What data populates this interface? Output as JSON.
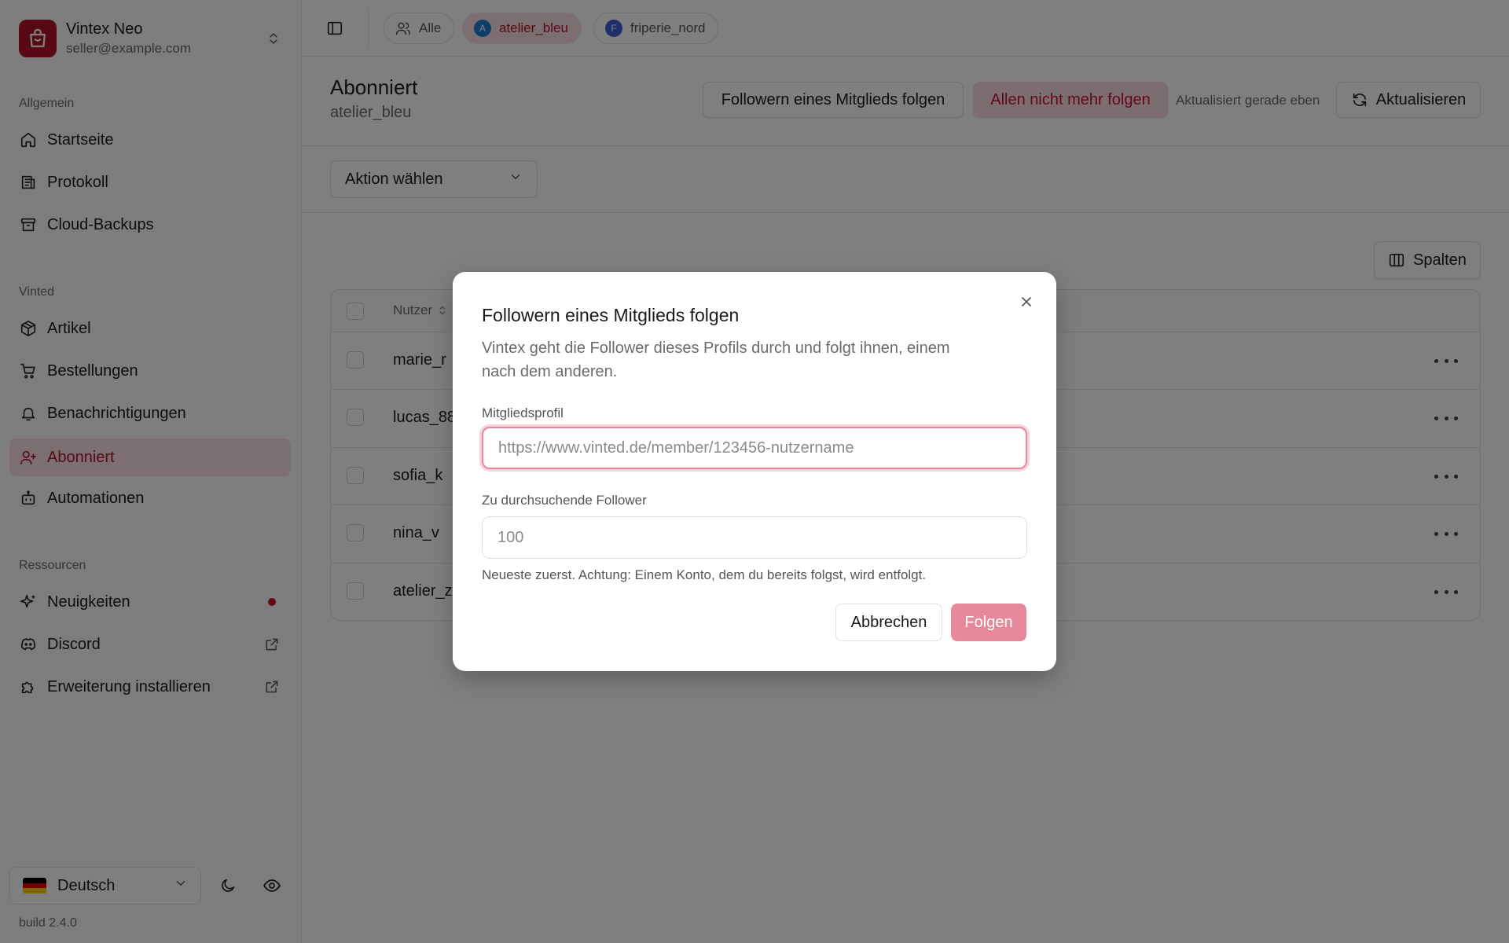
{
  "account": {
    "name": "Vintex Neo",
    "email": "seller@example.com"
  },
  "sidebar": {
    "sections": [
      {
        "label": "Allgemein",
        "items": [
          {
            "label": "Startseite",
            "icon": "home-icon"
          },
          {
            "label": "Protokoll",
            "icon": "log-icon"
          },
          {
            "label": "Cloud-Backups",
            "icon": "archive-icon"
          }
        ]
      },
      {
        "label": "Vinted",
        "items": [
          {
            "label": "Artikel",
            "icon": "package-icon"
          },
          {
            "label": "Bestellungen",
            "icon": "cart-icon"
          },
          {
            "label": "Benachrichtigungen",
            "icon": "bell-icon"
          },
          {
            "label": "Abonniert",
            "icon": "user-plus-icon",
            "active": true
          },
          {
            "label": "Automationen",
            "icon": "bot-icon"
          }
        ]
      },
      {
        "label": "Ressourcen",
        "items": [
          {
            "label": "Neuigkeiten",
            "icon": "sparkles-icon",
            "badge": "dot"
          },
          {
            "label": "Discord",
            "icon": "discord-icon",
            "external": true
          },
          {
            "label": "Erweiterung installieren",
            "icon": "puzzle-icon",
            "external": true
          }
        ]
      }
    ],
    "language": "Deutsch",
    "build": "build 2.4.0"
  },
  "topbar": {
    "chips": [
      {
        "label": "Alle",
        "icon": "users-icon"
      },
      {
        "label": "atelier_bleu",
        "avatar": "A",
        "avatar_color": "#1f7fd1",
        "active": true
      },
      {
        "label": "friperie_nord",
        "avatar": "F",
        "avatar_color": "#3f5bd6"
      }
    ]
  },
  "header": {
    "title": "Abonniert",
    "subtitle": "atelier_bleu",
    "follow_followers_button": "Followern eines Mitglieds folgen",
    "unfollow_all_button": "Allen nicht mehr folgen",
    "updated_text": "Aktualisiert gerade eben",
    "refresh_button": "Aktualisieren"
  },
  "toolbar": {
    "action_select": "Aktion wählen",
    "columns_button": "Spalten"
  },
  "table": {
    "user_header": "Nutzer",
    "rows": [
      "marie_r",
      "lucas_88",
      "sofia_k",
      "nina_v",
      "atelier_z"
    ]
  },
  "modal": {
    "title": "Followern eines Mitglieds folgen",
    "description": "Vintex geht die Follower dieses Profils durch und folgt ihnen, einem nach dem anderen.",
    "profile_label": "Mitgliedsprofil",
    "profile_placeholder": "https://www.vinted.de/member/123456-nutzername",
    "count_label": "Zu durchsuchende Follower",
    "count_placeholder": "100",
    "hint": "Neueste zuerst. Achtung: Einem Konto, dem du bereits folgst, wird entfolgt.",
    "cancel_button": "Abbrechen",
    "submit_button": "Folgen"
  },
  "colors": {
    "accent": "#b11226",
    "accent_soft": "#f6dfe3",
    "primary_disabled": "#e7899a"
  }
}
